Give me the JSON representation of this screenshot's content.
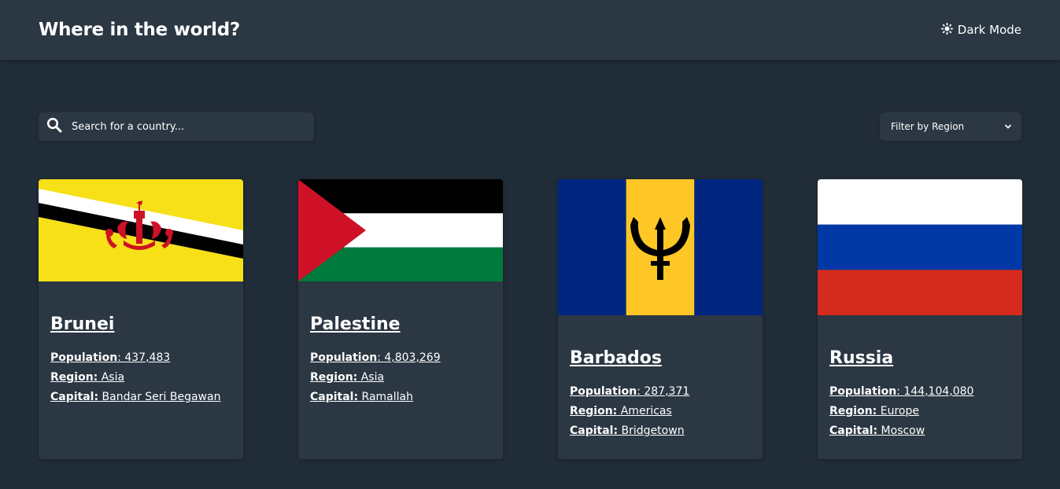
{
  "header": {
    "title": "Where in the world?",
    "theme_toggle_label": "Dark Mode"
  },
  "search": {
    "placeholder": "Search for a country..."
  },
  "filter": {
    "label": "Filter by Region"
  },
  "labels": {
    "population": "Population",
    "region": "Region:",
    "capital": "Capital:"
  },
  "countries": [
    {
      "name": "Brunei",
      "population": ": 437,483",
      "region": "Asia",
      "capital": "Bandar Seri Begawan"
    },
    {
      "name": "Palestine",
      "population": ": 4,803,269",
      "region": "Asia",
      "capital": "Ramallah"
    },
    {
      "name": "Barbados",
      "population": ": 287,371",
      "region": "Americas",
      "capital": "Bridgetown"
    },
    {
      "name": "Russia",
      "population": ": 144,104,080",
      "region": "Europe",
      "capital": "Moscow"
    }
  ],
  "colors": {
    "background": "#202c37",
    "surface": "#2b3743",
    "text": "#ffffff"
  }
}
